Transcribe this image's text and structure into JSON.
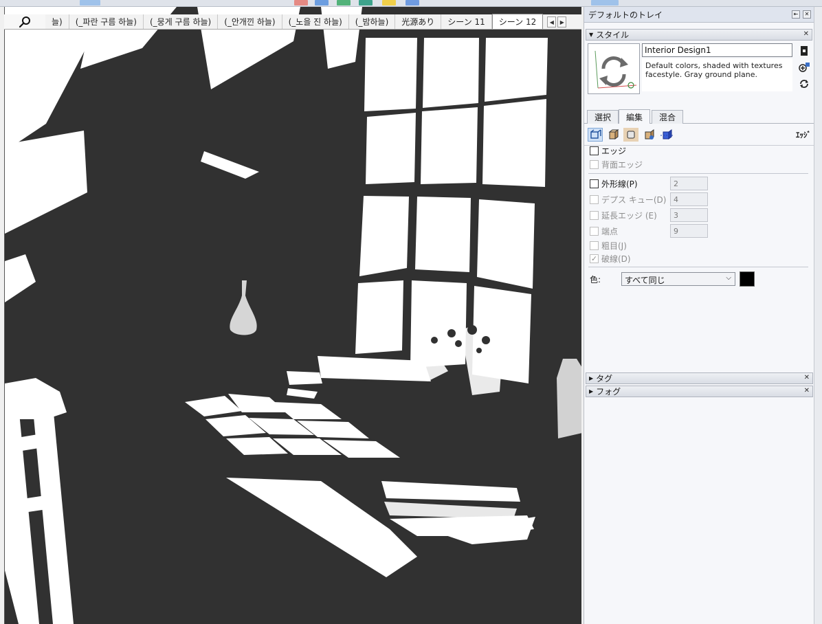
{
  "scene_tabs": {
    "items": [
      {
        "label": "늘)"
      },
      {
        "label": "(_파란 구름 하늘)"
      },
      {
        "label": "(_뭉게 구름 하늘)"
      },
      {
        "label": "(_안개낀 하늘)"
      },
      {
        "label": "(_노을 진 하늘)"
      },
      {
        "label": "(_밤하늘)"
      },
      {
        "label": "光源あり"
      },
      {
        "label": "シーン 11"
      },
      {
        "label": "シーン 12"
      }
    ],
    "active_index": 8,
    "search_icon": "search-icon",
    "prev_arrow": "◀",
    "next_arrow": "▶"
  },
  "tray": {
    "title": "デフォルトのトレイ",
    "styles_panel": {
      "header": "スタイル",
      "style_name": "Interior Design1",
      "description": "Default colors, shaded with textures facestyle. Gray ground plane.",
      "tabs": [
        "選択",
        "編集",
        "混合"
      ],
      "active_tab": 1,
      "edit_section_label": "ｴｯｼﾞ",
      "options": {
        "edges": {
          "label": "エッジ",
          "checked": false,
          "enabled": true
        },
        "back_edges": {
          "label": "背面エッジ",
          "checked": false,
          "enabled": false
        },
        "profiles": {
          "label": "外形線(P)",
          "value": "2",
          "checked": false,
          "enabled": true
        },
        "depth_cue": {
          "label": "デプス キュー(D)",
          "value": "4",
          "checked": false,
          "enabled": false
        },
        "extension": {
          "label": "延長エッジ (E)",
          "value": "3",
          "checked": false,
          "enabled": false
        },
        "endpoints": {
          "label": "端点",
          "value": "9",
          "checked": false,
          "enabled": false
        },
        "jitter": {
          "label": "粗目(J)",
          "checked": false,
          "enabled": false
        },
        "dashes": {
          "label": "破線(D)",
          "checked": true,
          "enabled": false
        }
      },
      "color": {
        "label": "色:",
        "selected": "すべて同じ",
        "swatch": "#000000"
      }
    },
    "tags_panel": {
      "header": "タグ"
    },
    "fog_panel": {
      "header": "フォグ"
    }
  },
  "colors": {
    "viewport_bg": "#313131",
    "light": "#ffffff",
    "tray_bg": "#f6f7fa"
  }
}
